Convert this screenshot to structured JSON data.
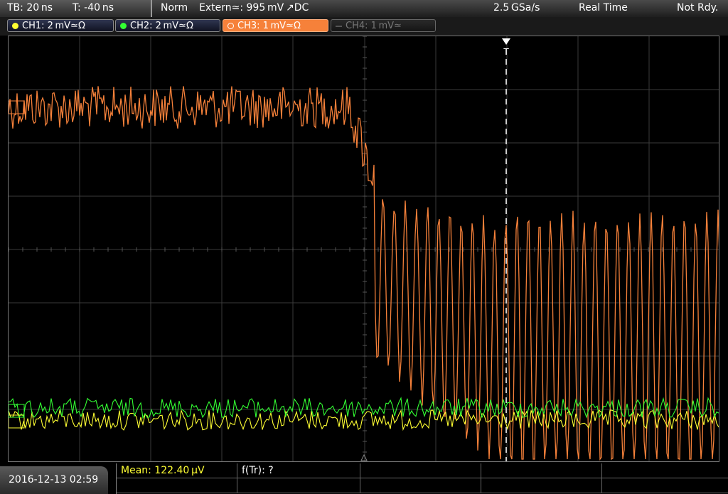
{
  "topbar": {
    "timebase": "TB: 20 ns",
    "trigger_time": "T: -40 ns",
    "trigger_mode": "Norm",
    "trigger_source": "Extern≃: 995 mV ↗DC",
    "sample_rate": "2.5 GSa/s",
    "acq_mode": "Real Time",
    "status": "Not Rdy."
  },
  "channels": [
    {
      "label": "CH1: 2 mV≃Ω",
      "color": "#ffff33",
      "state": "on"
    },
    {
      "label": "CH2: 2 mV≃Ω",
      "color": "#33ff33",
      "state": "on"
    },
    {
      "label": "CH3: 1 mV≃Ω",
      "color": "#f6813a",
      "state": "active"
    },
    {
      "label": "CH4: 1 mV≃",
      "color": "#777777",
      "state": "off"
    }
  ],
  "colors": {
    "ch1_trace": "#ffff33",
    "ch2_trace": "#33ff33",
    "ch3_trace": "#f6813a",
    "grid": "#3a3a3a",
    "cursor": "#ffffff"
  },
  "markers": {
    "trigger_marker": "T",
    "trigger_arrow_icon": "down-triangle-icon"
  },
  "bottombar": {
    "datetime": "2016-12-13 02:59",
    "mean_label": "Mean: 122.40 µV",
    "ftr_label": "f(Tr): ?"
  }
}
